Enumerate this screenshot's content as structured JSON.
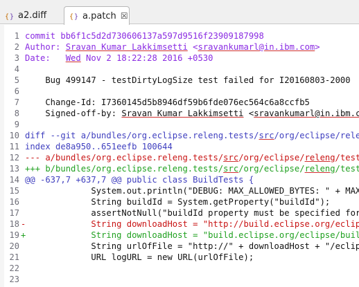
{
  "tabs": [
    {
      "label": "a2.diff",
      "active": false,
      "icon": "patch-file-icon"
    },
    {
      "label": "a.patch",
      "active": true,
      "icon": "patch-file-icon",
      "close_glyph": "☒"
    }
  ],
  "lines": [
    {
      "n": "1",
      "type": "meta",
      "parts": [
        {
          "t": "commit bb6f1c5d2d730606137a597d9516f23909187998"
        }
      ]
    },
    {
      "n": "2",
      "type": "meta",
      "parts": [
        {
          "t": "Author: "
        },
        {
          "t": "Sravan Kumar Lakkimsetti",
          "u": true
        },
        {
          "t": " <"
        },
        {
          "t": "sravankumarl@in.ibm.com",
          "u": true
        },
        {
          "t": ">"
        }
      ]
    },
    {
      "n": "3",
      "type": "meta",
      "parts": [
        {
          "t": "Date:   "
        },
        {
          "t": "Wed",
          "u": true
        },
        {
          "t": " Nov 2 18:22:28 2016 +0530"
        }
      ]
    },
    {
      "n": "4",
      "type": "text",
      "parts": [
        {
          "t": ""
        }
      ]
    },
    {
      "n": "5",
      "type": "text",
      "parts": [
        {
          "t": "    Bug 499147 - testDirtyLogSize test failed for I20160803-2000"
        }
      ]
    },
    {
      "n": "6",
      "type": "text",
      "parts": [
        {
          "t": ""
        }
      ]
    },
    {
      "n": "7",
      "type": "text",
      "parts": [
        {
          "t": "    Change-Id: I7360145d5b8946df59b6fde076ec564c6a8ccfb5"
        }
      ]
    },
    {
      "n": "8",
      "type": "text",
      "parts": [
        {
          "t": "    Signed-off-by: "
        },
        {
          "t": "Sravan Kumar Lakkimsetti",
          "u": true
        },
        {
          "t": " <"
        },
        {
          "t": "sravankumarl@in.ibm.com",
          "u": true
        },
        {
          "t": ">"
        }
      ]
    },
    {
      "n": "9",
      "type": "text",
      "parts": [
        {
          "t": ""
        }
      ]
    },
    {
      "n": "10",
      "type": "diff",
      "parts": [
        {
          "t": "diff --git a/bundles/org.eclipse.releng.tests/"
        },
        {
          "t": "src",
          "u": true
        },
        {
          "t": "/org/eclipse/releng/tests/BuildTests.java"
        }
      ]
    },
    {
      "n": "11",
      "type": "diff",
      "parts": [
        {
          "t": "index de8a950..651eefb 100644"
        }
      ]
    },
    {
      "n": "12",
      "type": "minus",
      "parts": [
        {
          "t": "--- a/bundles/org.eclipse.releng.tests/"
        },
        {
          "t": "src",
          "u": true
        },
        {
          "t": "/org/eclipse/"
        },
        {
          "t": "releng",
          "u": true
        },
        {
          "t": "/tests/BuildTests.java"
        }
      ]
    },
    {
      "n": "13",
      "type": "plus",
      "parts": [
        {
          "t": "+++ b/bundles/org.eclipse.releng.tests/"
        },
        {
          "t": "src",
          "u": true
        },
        {
          "t": "/org/eclipse/"
        },
        {
          "t": "releng",
          "u": true
        },
        {
          "t": "/tests/BuildTests.java"
        }
      ]
    },
    {
      "n": "14",
      "type": "diff",
      "parts": [
        {
          "t": "@@ -637,7 +637,7 @@ public class BuildTests {"
        }
      ]
    },
    {
      "n": "15",
      "type": "text",
      "parts": [
        {
          "t": "             System.out.println(\"DEBUG: MAX_ALLOWED_BYTES: \" + MAX_ALLOWED_BYTES);"
        }
      ]
    },
    {
      "n": "16",
      "type": "text",
      "parts": [
        {
          "t": "             String buildId = System.getProperty(\"buildId\");"
        }
      ]
    },
    {
      "n": "17",
      "type": "text",
      "parts": [
        {
          "t": "             assertNotNull(\"buildId property must be specified for testDirtyLogSize\", buildId);"
        }
      ]
    },
    {
      "n": "18",
      "type": "minus",
      "marker": "-",
      "parts": [
        {
          "t": "             String downloadHost = \"http://build.eclipse.org/eclipse/builds\";"
        }
      ]
    },
    {
      "n": "19",
      "type": "plus",
      "marker": "+",
      "parts": [
        {
          "t": "             String downloadHost = \"build.eclipse.org/eclipse/builds\";"
        }
      ]
    },
    {
      "n": "20",
      "type": "text",
      "parts": [
        {
          "t": "             String urlOfFile = \"http://\" + downloadHost + \"/eclipse/\" + buildId;"
        }
      ]
    },
    {
      "n": "21",
      "type": "text",
      "parts": [
        {
          "t": "             URL logURL = new URL(urlOfFile);"
        }
      ]
    },
    {
      "n": "22",
      "type": "text",
      "parts": [
        {
          "t": ""
        }
      ]
    },
    {
      "n": "23",
      "type": "text",
      "parts": [
        {
          "t": ""
        }
      ]
    }
  ]
}
